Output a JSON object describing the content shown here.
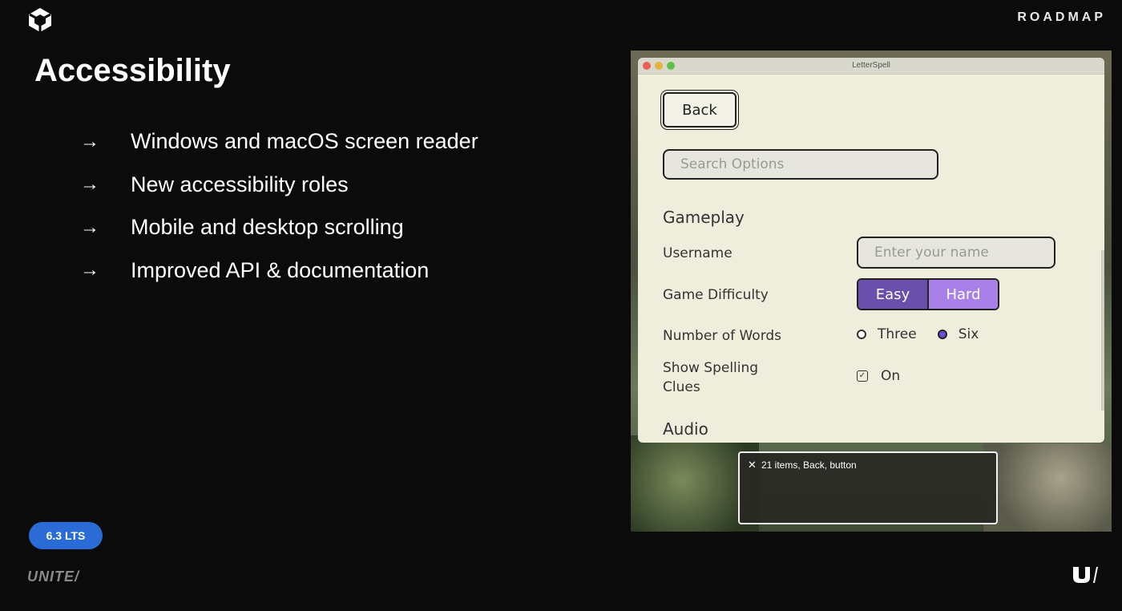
{
  "header": {
    "section": "ROADMAP",
    "logo": "unity-cube-icon"
  },
  "slide": {
    "title": "Accessibility",
    "bullets": [
      "Windows and macOS screen reader",
      "New accessibility roles",
      "Mobile and desktop scrolling",
      "Improved API & documentation"
    ],
    "arrow": "→",
    "badge": "6.3 LTS",
    "footer_logo": "UNITE/",
    "footer_mark": "u-slash-logo-icon"
  },
  "app": {
    "window_title": "LetterSpell",
    "back_label": "Back",
    "search_placeholder": "Search Options",
    "section_gameplay": "Gameplay",
    "username_label": "Username",
    "username_placeholder": "Enter your name",
    "difficulty_label": "Game Difficulty",
    "difficulty_options": [
      "Easy",
      "Hard"
    ],
    "difficulty_selected": "Easy",
    "words_label": "Number of Words",
    "words_options": [
      "Three",
      "Six"
    ],
    "words_selected": "Six",
    "clues_label_line1": "Show Spelling",
    "clues_label_line2": "Clues",
    "clues_value": "On",
    "clues_checked": true,
    "section_audio": "Audio"
  },
  "screen_reader": {
    "close": "✕",
    "text": "21 items, Back, button"
  },
  "colors": {
    "badge": "#2a6bd6",
    "easy": "#6b4fad",
    "hard": "#a880e8",
    "window_bg": "#efeedd"
  }
}
